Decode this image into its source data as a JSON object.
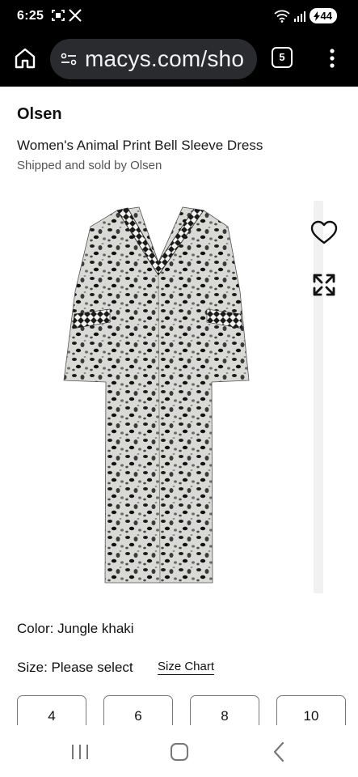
{
  "status_bar": {
    "time": "6:25",
    "battery": "44",
    "icons": [
      "screenshot-icon",
      "x-app-icon",
      "wifi-icon",
      "signal-icon",
      "battery-icon"
    ]
  },
  "browser": {
    "url": "macys.com/sho",
    "tab_count": "5",
    "icons": [
      "home-icon",
      "site-settings-icon",
      "more-vertical-icon"
    ]
  },
  "product": {
    "brand": "Olsen",
    "title": "Women's Animal Print Bell Sleeve Dress",
    "seller": "Shipped and sold by Olsen",
    "color_text": "Color: Jungle khaki",
    "size_text": "Size: Please select",
    "size_chart_label": "Size Chart",
    "sizes": [
      "4",
      "6",
      "8",
      "10"
    ]
  },
  "image_actions": [
    "heart-icon",
    "expand-icon"
  ],
  "nav_bar": [
    "recent-apps-icon",
    "home-nav-icon",
    "back-icon"
  ],
  "colors": {
    "chrome_bg": "#000000",
    "url_pill": "#2a2b2f",
    "text": "#111111",
    "muted": "#555555"
  }
}
